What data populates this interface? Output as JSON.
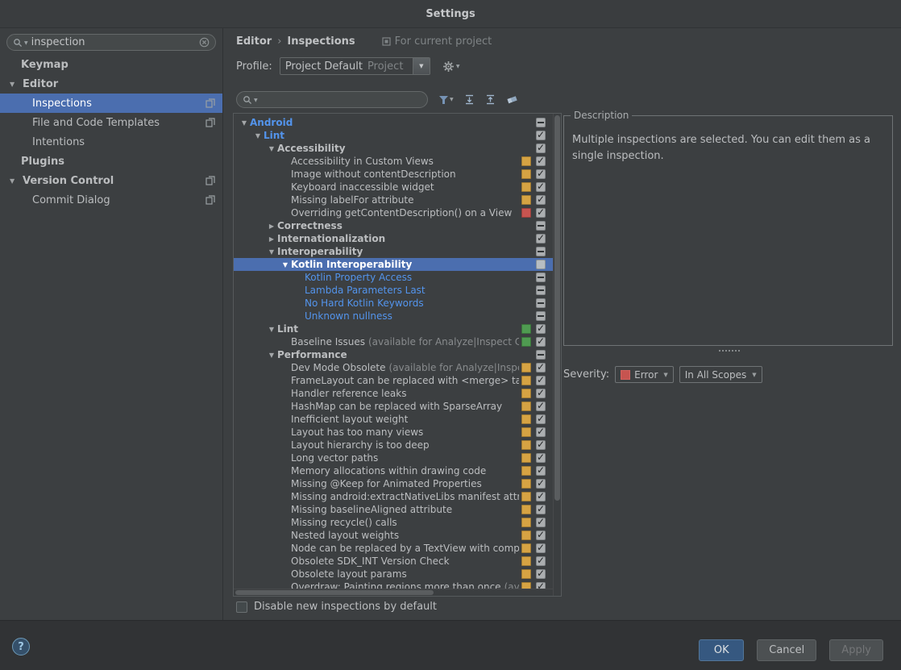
{
  "window": {
    "title": "Settings"
  },
  "icons": {
    "expand_arrow": "▼",
    "collapse_arrow": "▶",
    "dropdown_arrow": "▼",
    "breadcrumb_separator": "›",
    "help": "?"
  },
  "colors": {
    "selection": "#4b6eaf",
    "link_blue": "#5394ec",
    "badge_yellow": "#d6a343",
    "badge_red": "#c75450",
    "badge_green": "#4f9b51"
  },
  "sidebar": {
    "search": {
      "value": "inspection"
    },
    "items": [
      {
        "label": "Keymap",
        "level": 1,
        "bold": true
      },
      {
        "label": "Editor",
        "level": 0,
        "bold": true,
        "arrow": "down"
      },
      {
        "label": "Inspections",
        "level": 2,
        "selected": true,
        "right_icon": true
      },
      {
        "label": "File and Code Templates",
        "level": 2,
        "right_icon": true
      },
      {
        "label": "Intentions",
        "level": 2
      },
      {
        "label": "Plugins",
        "level": 1,
        "bold": true
      },
      {
        "label": "Version Control",
        "level": 0,
        "bold": true,
        "arrow": "down",
        "right_icon": true
      },
      {
        "label": "Commit Dialog",
        "level": 2,
        "right_icon": true
      }
    ]
  },
  "header": {
    "breadcrumb": {
      "item1": "Editor",
      "separator": "›",
      "item2": "Inspections"
    },
    "scope_label": "For current project",
    "profile_label": "Profile:",
    "profile_value": "Project Default",
    "profile_hint": "Project"
  },
  "toolbar": {
    "search_value": "",
    "icon_names": [
      "filter-icon",
      "expand-all-icon",
      "collapse-all-icon",
      "reset-icon"
    ]
  },
  "tree": {
    "rows": [
      {
        "label": "Android",
        "level": 0,
        "arrow": "down",
        "style": "blue-bold",
        "check": "dash"
      },
      {
        "label": "Lint",
        "level": 1,
        "arrow": "down",
        "style": "blue-bold",
        "check": "checked"
      },
      {
        "label": "Accessibility",
        "level": 2,
        "arrow": "down",
        "style": "bold",
        "check": "checked"
      },
      {
        "label": "Accessibility in Custom Views",
        "level": 3,
        "style": "plain",
        "badge": "yellow",
        "check": "checked"
      },
      {
        "label": "Image without contentDescription",
        "level": 3,
        "style": "plain",
        "badge": "yellow",
        "check": "checked"
      },
      {
        "label": "Keyboard inaccessible widget",
        "level": 3,
        "style": "plain",
        "badge": "yellow",
        "check": "checked"
      },
      {
        "label": "Missing labelFor attribute",
        "level": 3,
        "style": "plain",
        "badge": "yellow",
        "check": "checked"
      },
      {
        "label": "Overriding getContentDescription() on a View",
        "level": 3,
        "style": "plain",
        "badge": "red",
        "check": "checked"
      },
      {
        "label": "Correctness",
        "level": 2,
        "arrow": "right",
        "style": "bold",
        "check": "dash"
      },
      {
        "label": "Internationalization",
        "level": 2,
        "arrow": "right",
        "style": "bold",
        "check": "checked"
      },
      {
        "label": "Interoperability",
        "level": 2,
        "arrow": "down",
        "style": "bold",
        "check": "dash"
      },
      {
        "label": "Kotlin Interoperability",
        "level": 3,
        "arrow": "down",
        "style": "bold",
        "check": "empty",
        "selected": true
      },
      {
        "label": "Kotlin Property Access",
        "level": 4,
        "style": "blue",
        "check": "dash"
      },
      {
        "label": "Lambda Parameters Last",
        "level": 4,
        "style": "blue",
        "check": "dash"
      },
      {
        "label": "No Hard Kotlin Keywords",
        "level": 4,
        "style": "blue",
        "check": "dash"
      },
      {
        "label": "Unknown nullness",
        "level": 4,
        "style": "blue",
        "check": "dash"
      },
      {
        "label": "Lint",
        "level": 2,
        "arrow": "down",
        "style": "bold",
        "badge": "green",
        "check": "checked"
      },
      {
        "label": "Baseline Issues",
        "suffix": "(available for Analyze|Inspect Co",
        "level": 3,
        "style": "plain",
        "badge": "green",
        "check": "checked"
      },
      {
        "label": "Performance",
        "level": 2,
        "arrow": "down",
        "style": "bold",
        "check": "dash"
      },
      {
        "label": "Dev Mode Obsolete",
        "suffix": "(available for Analyze|Inspe",
        "level": 3,
        "style": "plain",
        "badge": "yellow",
        "check": "checked"
      },
      {
        "label": "FrameLayout can be replaced with <merge> ta",
        "level": 3,
        "style": "plain",
        "badge": "yellow",
        "check": "checked"
      },
      {
        "label": "Handler reference leaks",
        "level": 3,
        "style": "plain",
        "badge": "yellow",
        "check": "checked"
      },
      {
        "label": "HashMap can be replaced with SparseArray",
        "level": 3,
        "style": "plain",
        "badge": "yellow",
        "check": "checked"
      },
      {
        "label": "Inefficient layout weight",
        "level": 3,
        "style": "plain",
        "badge": "yellow",
        "check": "checked"
      },
      {
        "label": "Layout has too many views",
        "level": 3,
        "style": "plain",
        "badge": "yellow",
        "check": "checked"
      },
      {
        "label": "Layout hierarchy is too deep",
        "level": 3,
        "style": "plain",
        "badge": "yellow",
        "check": "checked"
      },
      {
        "label": "Long vector paths",
        "level": 3,
        "style": "plain",
        "badge": "yellow",
        "check": "checked"
      },
      {
        "label": "Memory allocations within drawing code",
        "level": 3,
        "style": "plain",
        "badge": "yellow",
        "check": "checked"
      },
      {
        "label": "Missing @Keep for Animated Properties",
        "level": 3,
        "style": "plain",
        "badge": "yellow",
        "check": "checked"
      },
      {
        "label": "Missing android:extractNativeLibs manifest attr",
        "level": 3,
        "style": "plain",
        "badge": "yellow",
        "check": "checked"
      },
      {
        "label": "Missing baselineAligned attribute",
        "level": 3,
        "style": "plain",
        "badge": "yellow",
        "check": "checked"
      },
      {
        "label": "Missing recycle() calls",
        "level": 3,
        "style": "plain",
        "badge": "yellow",
        "check": "checked"
      },
      {
        "label": "Nested layout weights",
        "level": 3,
        "style": "plain",
        "badge": "yellow",
        "check": "checked"
      },
      {
        "label": "Node can be replaced by a TextView with comp",
        "level": 3,
        "style": "plain",
        "badge": "yellow",
        "check": "checked"
      },
      {
        "label": "Obsolete SDK_INT Version Check",
        "level": 3,
        "style": "plain",
        "badge": "yellow",
        "check": "checked"
      },
      {
        "label": "Obsolete layout params",
        "level": 3,
        "style": "plain",
        "badge": "yellow",
        "check": "checked"
      },
      {
        "label": "Overdraw: Painting regions more than once",
        "suffix": "(av",
        "level": 3,
        "style": "plain",
        "badge": "yellow",
        "check": "checked"
      }
    ]
  },
  "description": {
    "title": "Description",
    "text": "Multiple inspections are selected. You can edit them as a single inspection."
  },
  "severity": {
    "label": "Severity:",
    "value": "Error",
    "value_color": "#c75450",
    "scope_value": "In All Scopes"
  },
  "footer": {
    "help_label": "?",
    "checkbox_label": "Disable new inspections by default",
    "checkbox_checked": false,
    "buttons": [
      {
        "label": "OK",
        "primary": true
      },
      {
        "label": "Cancel"
      },
      {
        "label": "Apply",
        "disabled": true
      }
    ]
  }
}
